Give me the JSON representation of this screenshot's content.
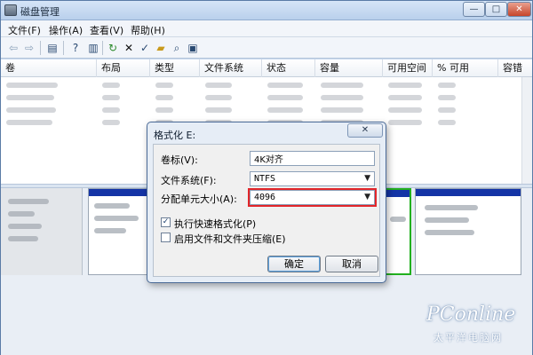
{
  "window": {
    "title": "磁盘管理",
    "controls": {
      "minimize": "—",
      "maximize": "□",
      "close": "✕"
    }
  },
  "menu": {
    "file": "文件(F)",
    "action": "操作(A)",
    "view": "查看(V)",
    "help": "帮助(H)"
  },
  "toolbar": {
    "icons": [
      "back-arrow-icon",
      "forward-arrow-icon",
      "properties-icon",
      "help-icon",
      "refresh-icon",
      "delete-icon",
      "open-icon",
      "folder-icon",
      "search-icon",
      "disk-check-icon"
    ]
  },
  "table": {
    "columns": [
      "卷",
      "布局",
      "类型",
      "文件系统",
      "状态",
      "容量",
      "可用空间",
      "% 可用",
      "容错"
    ]
  },
  "dialog": {
    "title": "格式化 E:",
    "close": "✕",
    "volume_label": "卷标(V):",
    "volume_value": "4K对齐",
    "filesystem_label": "文件系统(F):",
    "filesystem_value": "NTFS",
    "alloc_label": "分配单元大小(A):",
    "alloc_value": "4096",
    "quick_format_label": "执行快速格式化(P)",
    "quick_format_checked": true,
    "compress_label": "启用文件和文件夹压缩(E)",
    "compress_checked": false,
    "ok": "确定",
    "cancel": "取消"
  },
  "watermark": {
    "brand": "PConline",
    "sub": "太平洋电脑网"
  },
  "colors": {
    "highlight": "#e2262a",
    "partition_header": "#1434a6",
    "selected_partition": "#22b01f"
  }
}
